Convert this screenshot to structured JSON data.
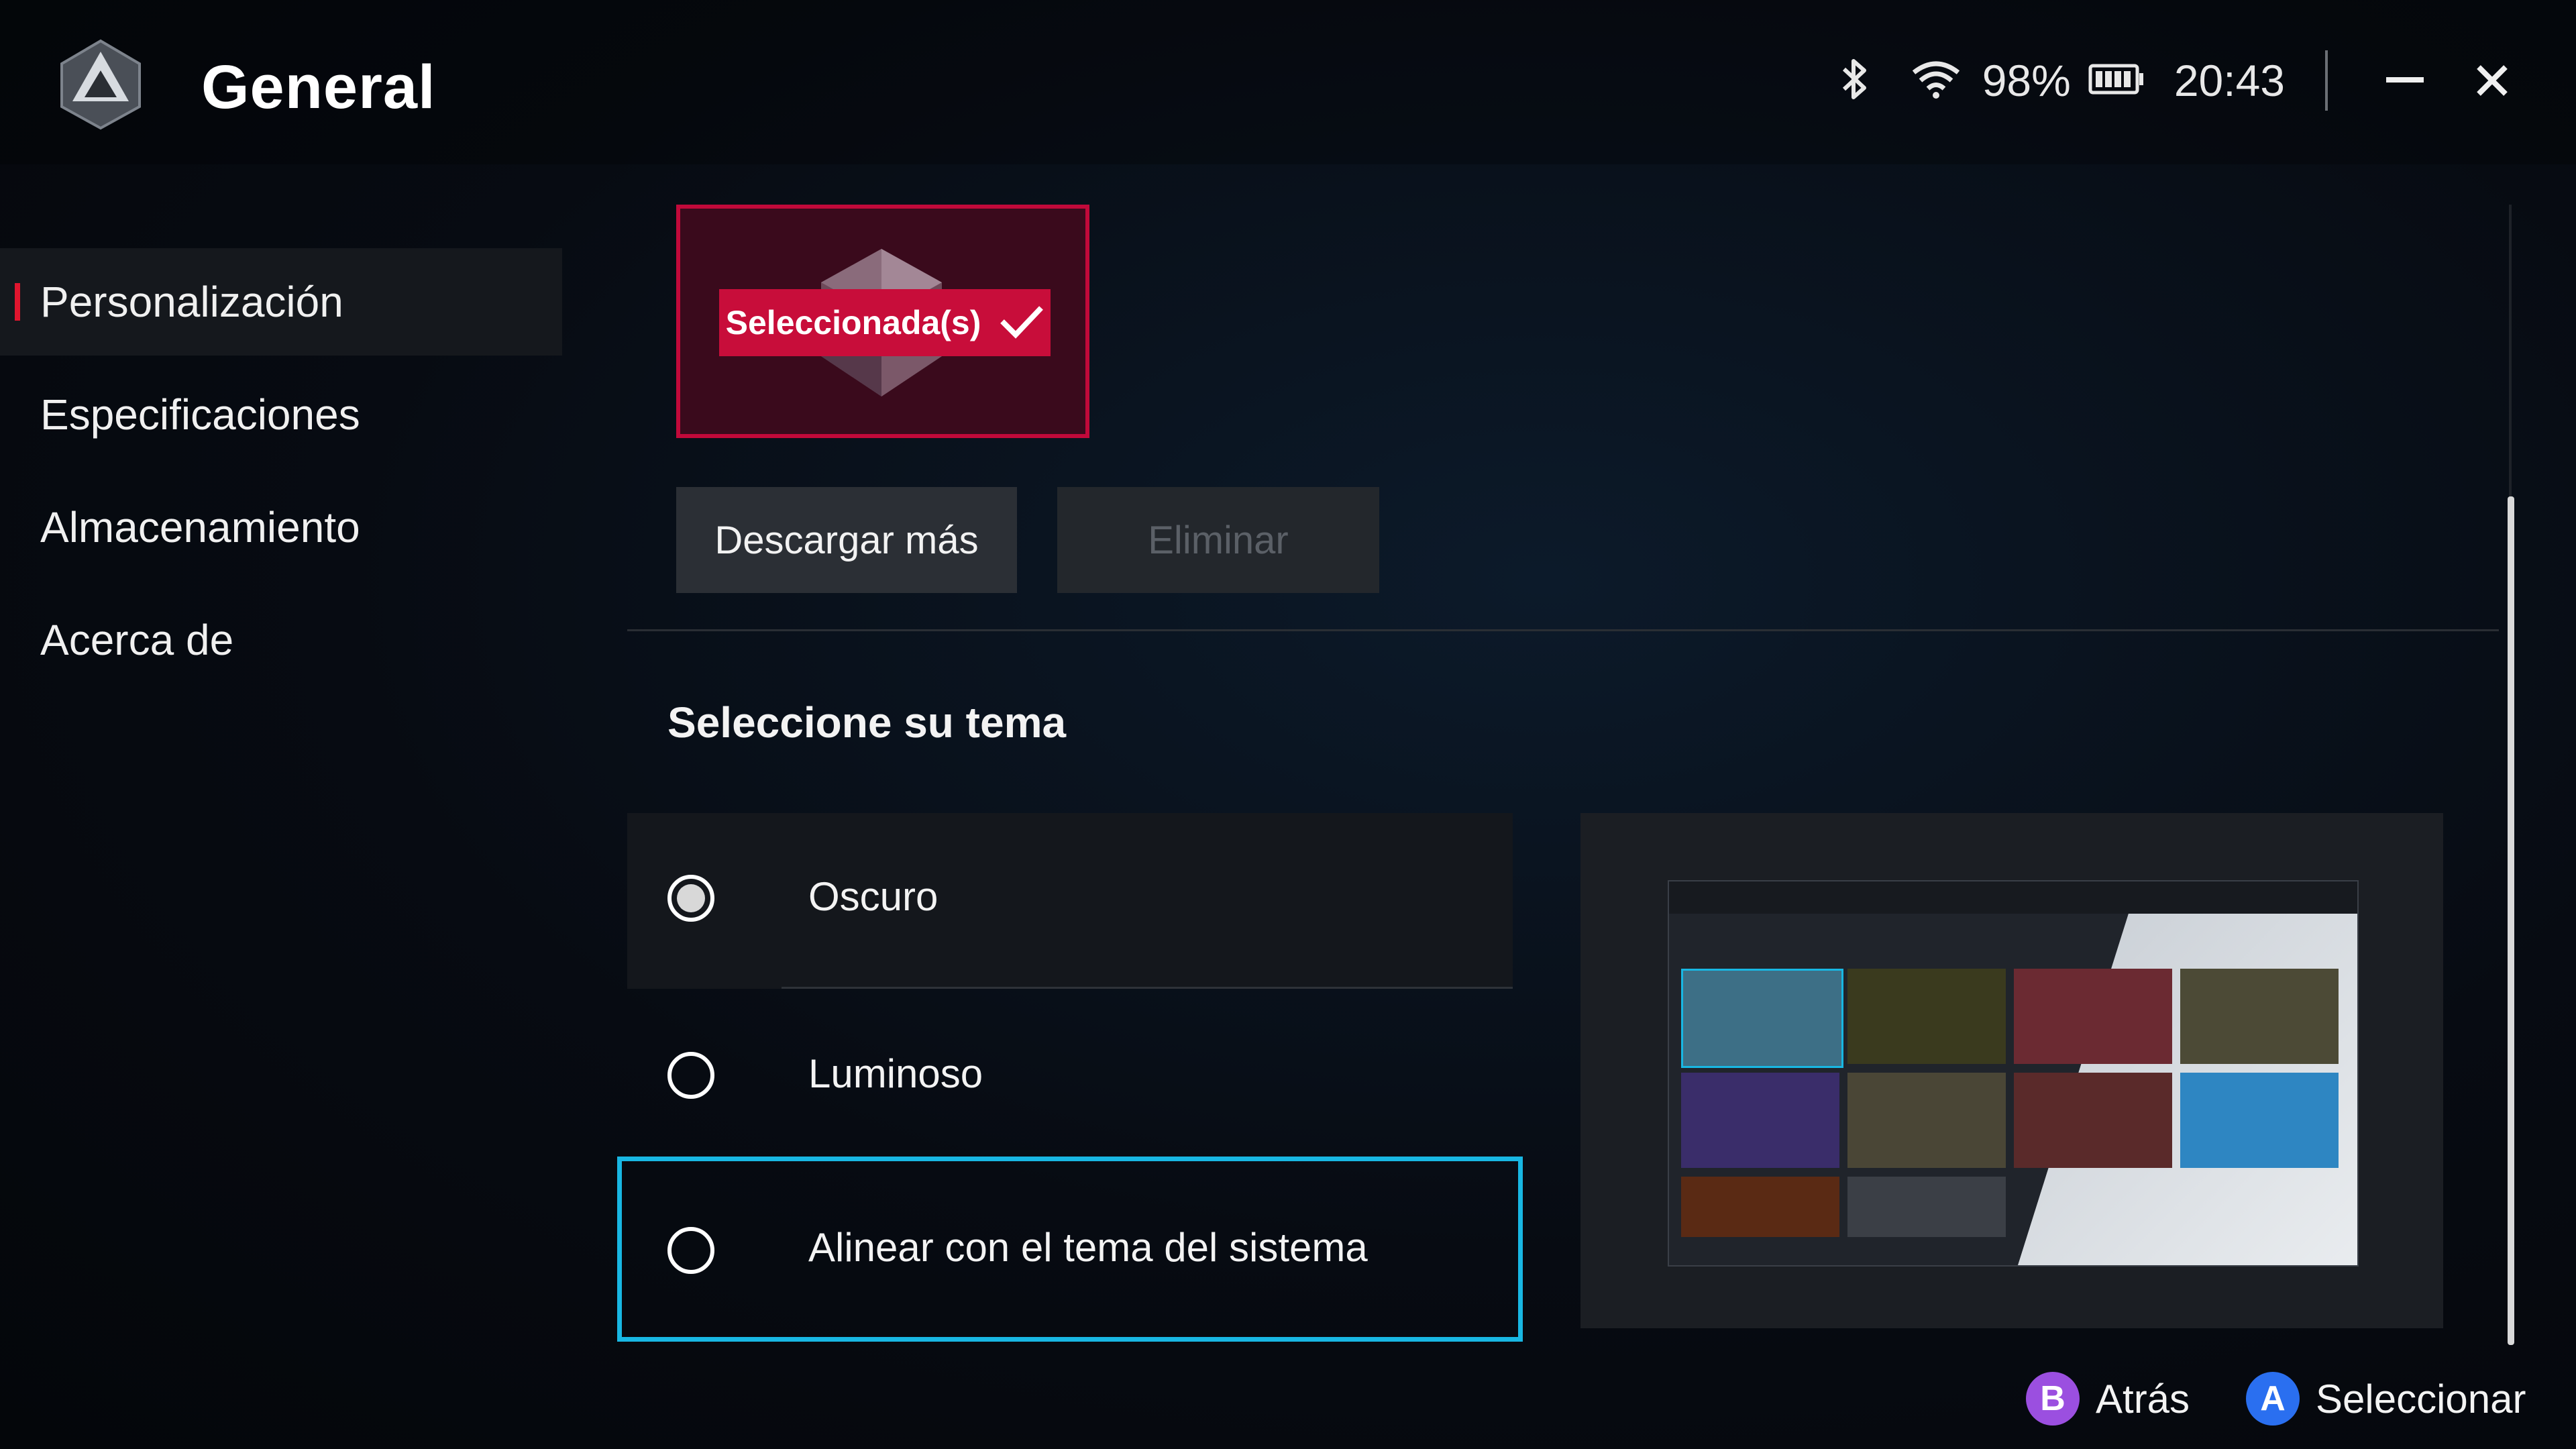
{
  "header": {
    "title": "General",
    "battery_percent": "98%",
    "time": "20:43"
  },
  "sidebar": {
    "items": [
      {
        "label": "Personalización",
        "active": true
      },
      {
        "label": "Especificaciones",
        "active": false
      },
      {
        "label": "Almacenamiento",
        "active": false
      },
      {
        "label": "Acerca de",
        "active": false
      }
    ]
  },
  "theme_card": {
    "selected_label": "Seleccionada(s)"
  },
  "actions": {
    "download_label": "Descargar más",
    "delete_label": "Eliminar"
  },
  "theme_section": {
    "heading": "Seleccione su tema",
    "options": [
      {
        "label": "Oscuro",
        "selected": true
      },
      {
        "label": "Luminoso",
        "selected": false
      },
      {
        "label": "Alinear con el tema del sistema",
        "selected": false,
        "focused": true
      }
    ]
  },
  "footer": {
    "back": {
      "button": "B",
      "label": "Atrás"
    },
    "select": {
      "button": "A",
      "label": "Seleccionar"
    }
  },
  "colors": {
    "accent_red": "#c80d3a",
    "focus_cyan": "#18b7e3",
    "hint_b": "#9b4fe0",
    "hint_a": "#2a6ff0"
  }
}
